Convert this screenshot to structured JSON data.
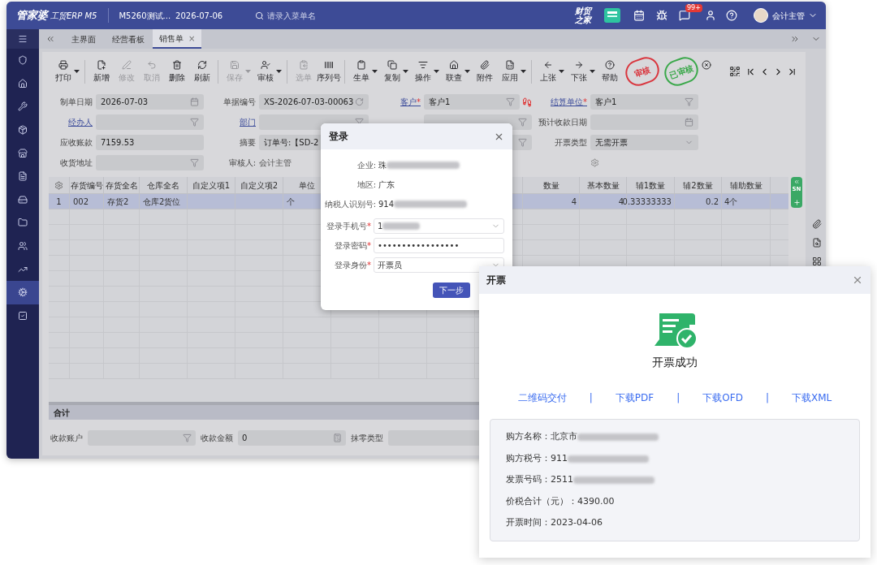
{
  "header": {
    "logo": "管家婆",
    "product": "工贸ERP M5",
    "account": "M5260测试...",
    "date": "2026-07-06",
    "search_placeholder": "请录入菜单名",
    "brand_top": "财贸",
    "brand_bottom": "之家",
    "badge": "99+",
    "user": "会计主管"
  },
  "sidebar": {
    "items": [
      {
        "selected": false
      },
      {
        "selected": false
      },
      {
        "selected": false
      },
      {
        "selected": false
      },
      {
        "selected": false
      },
      {
        "selected": false
      },
      {
        "selected": false
      },
      {
        "selected": false
      },
      {
        "selected": false
      },
      {
        "selected": false
      },
      {
        "selected": true
      },
      {
        "selected": false
      }
    ]
  },
  "tabs": [
    {
      "label": "主界面",
      "selected": false,
      "closable": false
    },
    {
      "label": "经营看板",
      "selected": false,
      "closable": false
    },
    {
      "label": "销售单",
      "selected": true,
      "closable": true,
      "close": "×"
    }
  ],
  "toolbar": {
    "groups": [
      [
        {
          "label": "打印",
          "disabled": false,
          "dropdown": true
        }
      ],
      [
        {
          "label": "新增",
          "disabled": false,
          "dropdown": false
        },
        {
          "label": "修改",
          "disabled": true,
          "dropdown": false
        },
        {
          "label": "取消",
          "disabled": true,
          "dropdown": false
        },
        {
          "label": "删除",
          "disabled": false,
          "dropdown": false
        },
        {
          "label": "刷新",
          "disabled": false,
          "dropdown": false
        }
      ],
      [
        {
          "label": "保存",
          "disabled": true,
          "dropdown": true
        },
        {
          "label": "审核",
          "disabled": false,
          "dropdown": true
        }
      ],
      [
        {
          "label": "选单",
          "disabled": true,
          "dropdown": false
        },
        {
          "label": "序列号",
          "disabled": false,
          "dropdown": false
        }
      ],
      [
        {
          "label": "生单",
          "disabled": false,
          "dropdown": true
        },
        {
          "label": "复制",
          "disabled": false,
          "dropdown": true
        },
        {
          "label": "操作",
          "disabled": false,
          "dropdown": true
        },
        {
          "label": "联查",
          "disabled": false,
          "dropdown": true
        },
        {
          "label": "附件",
          "disabled": false,
          "dropdown": false
        },
        {
          "label": "应用",
          "disabled": false,
          "dropdown": true
        }
      ],
      [
        {
          "label": "上张",
          "disabled": false,
          "dropdown": true
        },
        {
          "label": "下张",
          "disabled": false,
          "dropdown": true
        },
        {
          "label": "帮助",
          "disabled": false,
          "dropdown": false
        }
      ]
    ],
    "stamps": [
      {
        "text": "审核",
        "color": "#d9363e"
      },
      {
        "text": "已审核",
        "color": "#3aa84a"
      }
    ]
  },
  "form": [
    [
      {
        "label": "制单日期",
        "value": "2026-07-03",
        "kind": "date"
      },
      {
        "label": "单据编号",
        "value": "XS-2026-07-03-00063",
        "kind": "refresh"
      },
      {
        "label": "客户",
        "mark": "*",
        "link": true,
        "value": "客户1",
        "kind": "customer"
      },
      {
        "label": "结算单位",
        "mark": "*",
        "link": true,
        "value": "客户1",
        "kind": "filter"
      }
    ],
    [
      {
        "label": "经办人",
        "link": true,
        "kind": "filter"
      },
      {
        "label": "部门",
        "link": true,
        "kind": "filter"
      },
      {
        "kind": "filter"
      },
      {
        "label": "预计收款日期",
        "kind": "date"
      }
    ],
    [
      {
        "label": "应收账款",
        "value": "7159.53",
        "kind": "plain"
      },
      {
        "label": "摘要",
        "value": "订单号:【SD-2",
        "kind": "plain"
      },
      {
        "kind": "filter"
      },
      {
        "label": "开票类型",
        "value": "无需开票",
        "kind": "select"
      }
    ],
    [
      {
        "label": "收货地址",
        "kind": "filter"
      },
      {
        "label": "审核人:",
        "value": "会计主管",
        "kind": "text"
      },
      {
        "kind": "settings"
      }
    ]
  ],
  "table": {
    "columns_left": [
      "存货编号",
      "存货全名",
      "仓库全名",
      "自定义项1",
      "自定义项2",
      "单位"
    ],
    "columns_right": [
      "数量",
      "基本数量",
      "辅1数量",
      "辅2数量",
      "辅助数量"
    ],
    "rows": [
      {
        "index": "1",
        "selected": true,
        "cells_left": {
          "item_code": "002",
          "item_name": "存货2",
          "warehouse": "仓库2货位",
          "unit": "个"
        },
        "cells_right": [
          {
            "text": "4"
          },
          {
            "text": "4"
          },
          {
            "text": "0.33333333"
          },
          {
            "text": "0.2"
          },
          {
            "text": "4个"
          }
        ]
      }
    ],
    "side_tab": "SN",
    "total_label": "合计"
  },
  "footer": [
    {
      "label": "收款账户",
      "kind": "filter"
    },
    {
      "label": "收款金额",
      "value": "0",
      "kind": "calc"
    },
    {
      "label": "抹零类型",
      "kind": "plain"
    }
  ],
  "login": {
    "title": "登录",
    "info": [
      {
        "label": "企业:",
        "value": "珠",
        "redacted": true
      },
      {
        "label": "地区:",
        "value": "广东",
        "redacted": false
      },
      {
        "label": "纳税人识别号:",
        "value": "914",
        "redacted": true
      }
    ],
    "fields": [
      {
        "label": "登录手机号",
        "mark": "*",
        "value": "1",
        "redacted": true,
        "kind": "select"
      },
      {
        "label": "登录密码",
        "mark": "*",
        "value": "•••••••••••••••••",
        "redacted": false,
        "kind": "text"
      },
      {
        "label": "登录身份",
        "mark": "*",
        "value": "开票员",
        "redacted": false,
        "kind": "select"
      }
    ],
    "button": "下一步"
  },
  "invoice": {
    "title": "开票",
    "status": "开票成功",
    "links": [
      "二维码交付",
      "下载PDF",
      "下载OFD",
      "下载XML"
    ],
    "separator": "|",
    "details": [
      {
        "label": "购方名称：",
        "value": "北京市",
        "redacted": true
      },
      {
        "label": "购方税号：",
        "value": "911",
        "redacted": true
      },
      {
        "label": "发票号码：",
        "value": "2511",
        "redacted": true
      },
      {
        "label": "价税合计（元）：",
        "value": "4390.00",
        "redacted": false
      },
      {
        "label": "开票时间：",
        "value": "2023-04-06",
        "redacted": false
      }
    ]
  }
}
